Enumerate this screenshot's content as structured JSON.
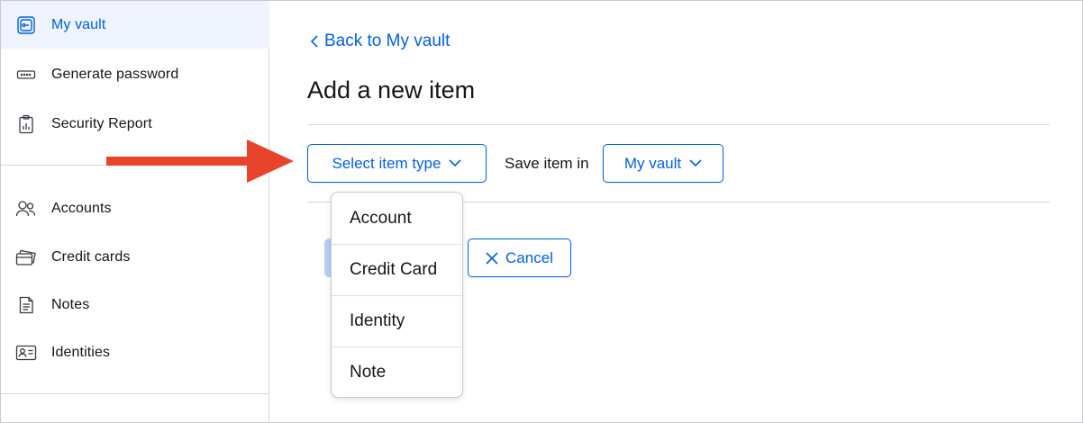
{
  "sidebar": {
    "items": [
      {
        "label": "My vault",
        "icon": "vault-icon",
        "active": true
      },
      {
        "label": "Generate password",
        "icon": "password-generator-icon"
      },
      {
        "label": "Security Report",
        "icon": "security-report-icon"
      },
      {
        "label": "Accounts",
        "icon": "accounts-icon"
      },
      {
        "label": "Credit cards",
        "icon": "credit-cards-icon"
      },
      {
        "label": "Notes",
        "icon": "notes-icon"
      },
      {
        "label": "Identities",
        "icon": "identities-icon"
      }
    ]
  },
  "main": {
    "back_link": "Back to My vault",
    "title": "Add a new item",
    "select_type_label": "Select item type",
    "save_in_label": "Save item in",
    "vault_select_label": "My vault",
    "cancel_label": "Cancel"
  },
  "dropdown": {
    "options": [
      "Account",
      "Credit Card",
      "Identity",
      "Note"
    ]
  },
  "colors": {
    "accent": "#0060df",
    "active_bg": "#eef3fe",
    "annotation_arrow": "#e8432b"
  }
}
